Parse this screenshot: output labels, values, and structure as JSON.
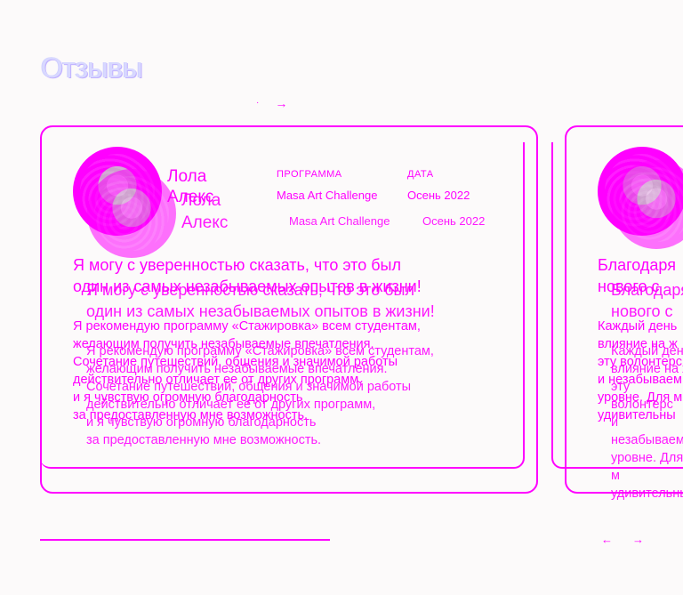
{
  "header": {
    "title": "Отзывы",
    "prev_icon": "·",
    "next_icon": "→"
  },
  "card1": {
    "name_line1": "Лола",
    "name_line2": "Алекс",
    "program_label": "ПРОГРАММА",
    "program_value": "Masa Art Challenge",
    "date_label": "ДАТА",
    "date_value": "Осень 2022",
    "quote_line1": "Я могу с уверенностью сказать, что это был",
    "quote_line2": "один из самых незабываемых опытов в жизни!",
    "body_lines": [
      "Я рекомендую программу «Стажировка» всем студентам,",
      "желающим получить незабываемые впечатления.",
      "Сочетание путешествий, общения и значимой работы",
      "действительно отличает ее от других программ,",
      "и я чувствую огромную благодарность",
      "за предоставленную мне возможность."
    ]
  },
  "card2": {
    "quote_line1": "Благодаря",
    "quote_line2": "нового с",
    "body_lines": [
      "Каждый день",
      "влияние на ж",
      "эту волонтерс",
      "и незабываем",
      "уровне. Для м",
      "удивительны"
    ]
  },
  "footer": {
    "prev_icon": "←",
    "next_icon": "→"
  }
}
